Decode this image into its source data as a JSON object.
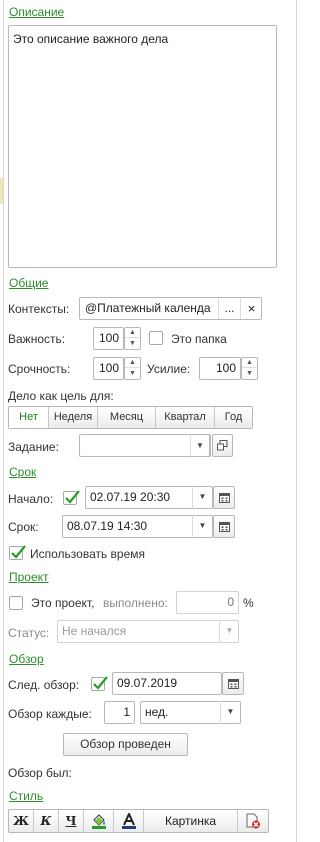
{
  "description": {
    "section": "Описание",
    "text": "Это описание важного дела"
  },
  "general": {
    "section": "Общие",
    "contexts_label": "Контексты:",
    "contexts_value": "@Платежный календа",
    "more_button": "...",
    "clear_button": "×",
    "importance_label": "Важность:",
    "importance_value": "100",
    "is_folder_label": "Это папка",
    "urgency_label": "Срочность:",
    "urgency_value": "100",
    "effort_label": "Усилие:",
    "effort_value": "100",
    "goal_label": "Дело как цель для:",
    "goal_tabs": [
      "Нет",
      "Неделя",
      "Месяц",
      "Квартал",
      "Год"
    ],
    "goal_selected": "Нет",
    "task_label": "Задание:",
    "task_value": ""
  },
  "term": {
    "section": "Срок",
    "start_label": "Начало:",
    "start_checked": true,
    "start_value": "02.07.19 20:30",
    "due_label": "Срок:",
    "due_value": "08.07.19 14:30",
    "use_time_label": "Использовать время",
    "use_time_checked": true
  },
  "project": {
    "section": "Проект",
    "is_project_label": "Это проект,",
    "done_label": "выполнено:",
    "done_value": "0",
    "percent": "%",
    "status_label": "Статус:",
    "status_value": "Не начался"
  },
  "review": {
    "section": "Обзор",
    "next_label": "След. обзор:",
    "next_checked": true,
    "next_value": "09.07.2019",
    "every_label": "Обзор каждые:",
    "every_value": "1",
    "every_unit": "нед.",
    "done_button": "Обзор проведен",
    "was_label": "Обзор был:"
  },
  "style": {
    "section": "Стиль",
    "bold": "Ж",
    "italic": "К",
    "underline": "Ч",
    "picture_button": "Картинка"
  },
  "colors": {
    "accent": "#2e8b2e",
    "check": "#2a9a2a",
    "border": "#b8b8b8"
  }
}
